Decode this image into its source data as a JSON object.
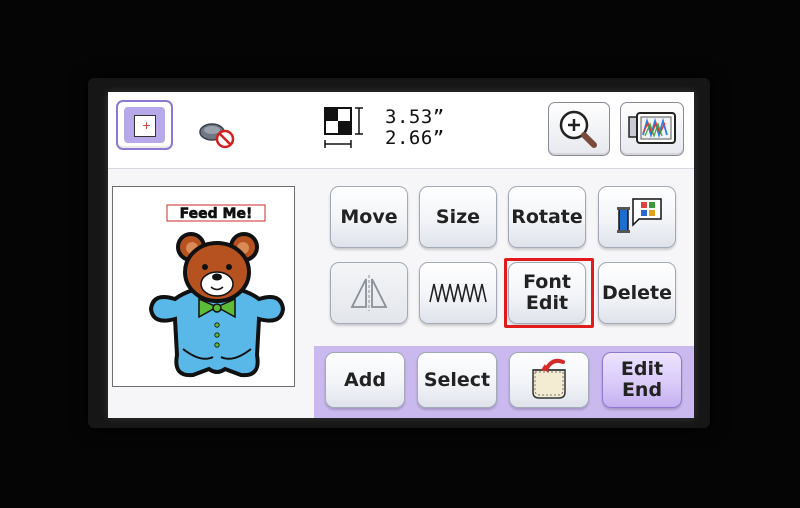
{
  "header": {
    "frame_icon": "embroidery-frame-icon",
    "no_frame_icon": "no-frame-icon",
    "size_icon": "pattern-size-icon",
    "width": "3.53”",
    "height": "2.66”",
    "zoom_icon": "magnifier-plus-icon",
    "embroider_icon": "embroidery-screen-icon"
  },
  "preview": {
    "text": "Feed Me!",
    "design": "teddy-bear-embroidery"
  },
  "buttons": {
    "move": "Move",
    "size": "Size",
    "rotate": "Rotate",
    "color_icon": "thread-color-palette-icon",
    "mirror_icon": "mirror-flip-icon",
    "density_icon": "density-zigzag-icon",
    "font_edit": "Font\nEdit",
    "delete": "Delete",
    "add": "Add",
    "select": "Select",
    "pocket_icon": "pocket-memory-icon",
    "edit_end": "Edit\nEnd"
  },
  "colors": {
    "highlight": "#e11b1b",
    "accent_purple": "#b7a8ea",
    "bear_brown": "#b5521f",
    "bear_body": "#5ab8e8",
    "bow_green": "#5dbb35"
  }
}
